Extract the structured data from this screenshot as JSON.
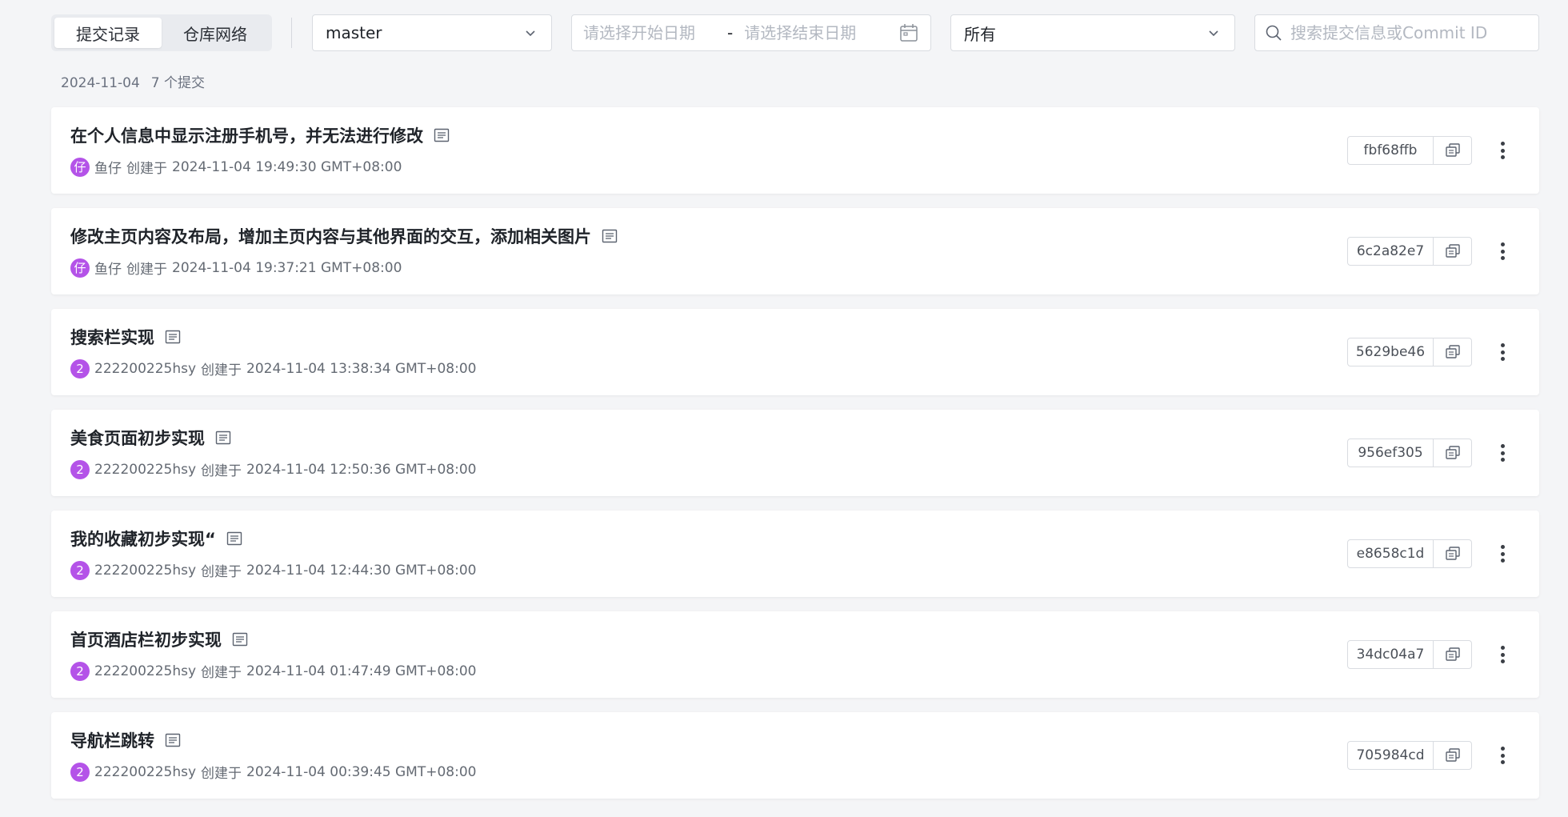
{
  "tabs": [
    {
      "label": "提交记录",
      "active": true
    },
    {
      "label": "仓库网络",
      "active": false
    }
  ],
  "branch_select": {
    "value": "master",
    "icon": "chevron-down-icon"
  },
  "date_range": {
    "start_placeholder": "请选择开始日期",
    "separator": "-",
    "end_placeholder": "请选择结束日期",
    "icon": "calendar-icon"
  },
  "author_filter": {
    "value": "所有",
    "icon": "chevron-down-icon"
  },
  "search": {
    "placeholder": "搜索提交信息或Commit ID",
    "icon": "search-icon"
  },
  "group": {
    "date": "2024-11-04",
    "count_text": "7 个提交"
  },
  "colors": {
    "avatar": "#b453e8",
    "background": "#f4f5f7"
  },
  "commits": [
    {
      "title": "在个人信息中显示注册手机号，并无法进行修改",
      "avatar": "仔",
      "author": "鱼仔",
      "created_label": "创建于",
      "time": "2024-11-04 19:49:30 GMT+08:00",
      "hash": "fbf68ffb"
    },
    {
      "title": "修改主页内容及布局，增加主页内容与其他界面的交互，添加相关图片",
      "avatar": "仔",
      "author": "鱼仔",
      "created_label": "创建于",
      "time": "2024-11-04 19:37:21 GMT+08:00",
      "hash": "6c2a82e7"
    },
    {
      "title": "搜索栏实现",
      "avatar": "2",
      "author": "222200225hsy",
      "created_label": "创建于",
      "time": "2024-11-04 13:38:34 GMT+08:00",
      "hash": "5629be46"
    },
    {
      "title": "美食页面初步实现",
      "avatar": "2",
      "author": "222200225hsy",
      "created_label": "创建于",
      "time": "2024-11-04 12:50:36 GMT+08:00",
      "hash": "956ef305"
    },
    {
      "title": "我的收藏初步实现“",
      "avatar": "2",
      "author": "222200225hsy",
      "created_label": "创建于",
      "time": "2024-11-04 12:44:30 GMT+08:00",
      "hash": "e8658c1d"
    },
    {
      "title": "首页酒店栏初步实现",
      "avatar": "2",
      "author": "222200225hsy",
      "created_label": "创建于",
      "time": "2024-11-04 01:47:49 GMT+08:00",
      "hash": "34dc04a7"
    },
    {
      "title": "导航栏跳转",
      "avatar": "2",
      "author": "222200225hsy",
      "created_label": "创建于",
      "time": "2024-11-04 00:39:45 GMT+08:00",
      "hash": "705984cd"
    }
  ]
}
